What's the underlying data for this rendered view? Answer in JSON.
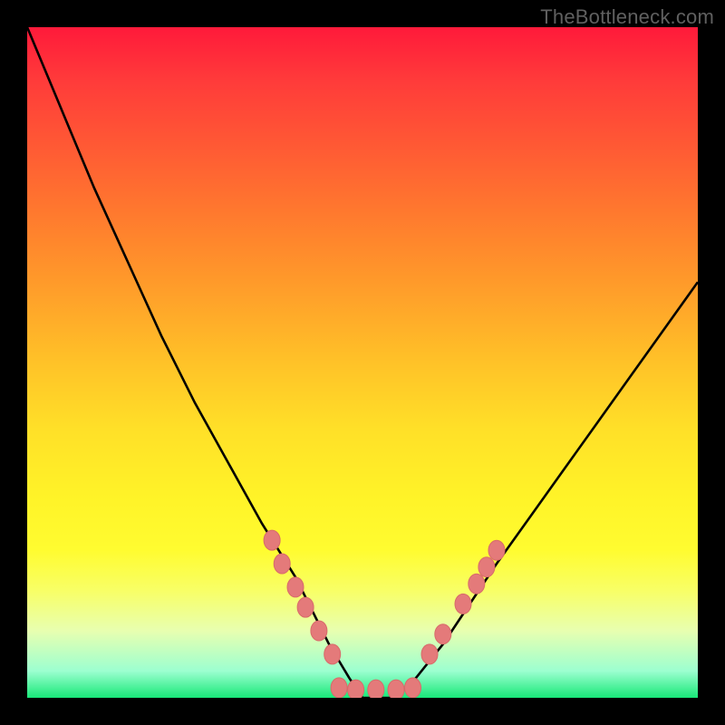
{
  "watermark": "TheBottleneck.com",
  "chart_data": {
    "type": "line",
    "title": "",
    "xlabel": "",
    "ylabel": "",
    "xlim": [
      0,
      100
    ],
    "ylim": [
      0,
      100
    ],
    "series": [
      {
        "name": "bottleneck-curve",
        "x": [
          0,
          5,
          10,
          15,
          20,
          25,
          30,
          35,
          40,
          45,
          48,
          50,
          52,
          55,
          58,
          62,
          66,
          70,
          75,
          80,
          85,
          90,
          95,
          100
        ],
        "y": [
          100,
          88,
          76,
          65,
          54,
          44,
          35,
          26,
          18,
          8,
          3,
          0,
          0,
          0,
          3,
          8,
          14,
          20,
          27,
          34,
          41,
          48,
          55,
          62
        ]
      }
    ],
    "markers": [
      {
        "name": "left-marker-1",
        "x": 36.5,
        "y": 23.5
      },
      {
        "name": "left-marker-2",
        "x": 38.0,
        "y": 20.0
      },
      {
        "name": "left-marker-3",
        "x": 40.0,
        "y": 16.5
      },
      {
        "name": "left-marker-4",
        "x": 41.5,
        "y": 13.5
      },
      {
        "name": "left-marker-5",
        "x": 43.5,
        "y": 10.0
      },
      {
        "name": "left-marker-6",
        "x": 45.5,
        "y": 6.5
      },
      {
        "name": "bottom-marker-1",
        "x": 46.5,
        "y": 1.5
      },
      {
        "name": "bottom-marker-2",
        "x": 49.0,
        "y": 1.2
      },
      {
        "name": "bottom-marker-3",
        "x": 52.0,
        "y": 1.2
      },
      {
        "name": "bottom-marker-4",
        "x": 55.0,
        "y": 1.2
      },
      {
        "name": "bottom-marker-5",
        "x": 57.5,
        "y": 1.5
      },
      {
        "name": "right-marker-1",
        "x": 60.0,
        "y": 6.5
      },
      {
        "name": "right-marker-2",
        "x": 62.0,
        "y": 9.5
      },
      {
        "name": "right-marker-3",
        "x": 65.0,
        "y": 14.0
      },
      {
        "name": "right-marker-4",
        "x": 67.0,
        "y": 17.0
      },
      {
        "name": "right-marker-5",
        "x": 68.5,
        "y": 19.5
      },
      {
        "name": "right-marker-6",
        "x": 70.0,
        "y": 22.0
      }
    ],
    "colors": {
      "curve": "#000000",
      "marker_fill": "#e47a7a",
      "marker_stroke": "#d86a6a",
      "gradient_top": "#ff1a3a",
      "gradient_bottom": "#18e878"
    }
  }
}
